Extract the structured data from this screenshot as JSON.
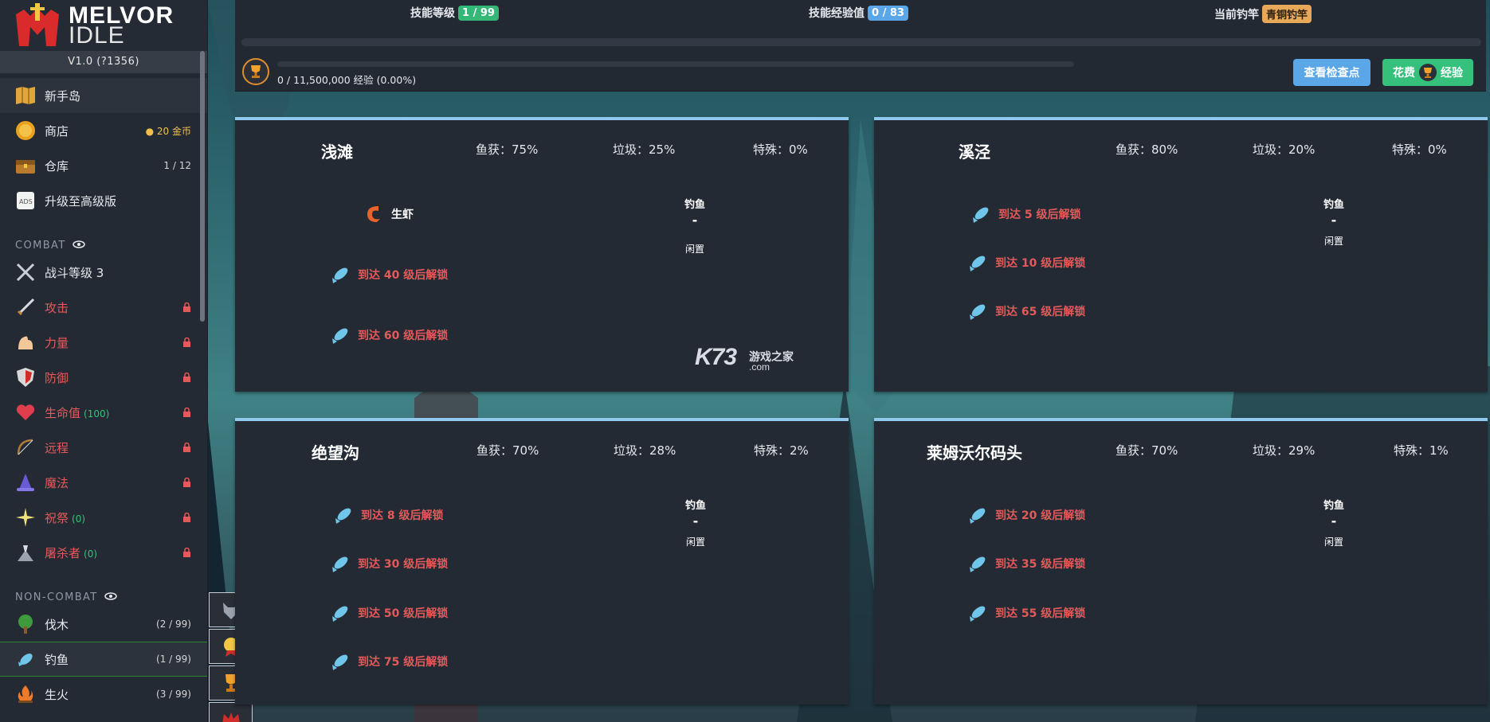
{
  "app": {
    "logo_line1": "MELVOR",
    "logo_line2": "IDLE",
    "version": "V1.0 (?1356)"
  },
  "sidebar": {
    "items_top": [
      {
        "label": "新手岛",
        "icon": "map-icon",
        "right": ""
      },
      {
        "label": "商店",
        "icon": "coin-icon",
        "right": "20 金币"
      },
      {
        "label": "仓库",
        "icon": "chest-icon",
        "right": "1 / 12"
      },
      {
        "label": "升级至高级版",
        "icon": "ads-icon",
        "right": ""
      }
    ],
    "combat_header": "COMBAT",
    "combat_items": [
      {
        "label": "战斗等级 3",
        "icon": "crossed-swords-icon",
        "sub": ""
      },
      {
        "label": "攻击",
        "icon": "sword-icon",
        "sub": ""
      },
      {
        "label": "力量",
        "icon": "flexed-arm-icon",
        "sub": ""
      },
      {
        "label": "防御",
        "icon": "shield-icon",
        "sub": ""
      },
      {
        "label": "生命值",
        "icon": "heart-icon",
        "sub": "(100)"
      },
      {
        "label": "远程",
        "icon": "bow-icon",
        "sub": ""
      },
      {
        "label": "魔法",
        "icon": "wizard-hat-icon",
        "sub": ""
      },
      {
        "label": "祝祭",
        "icon": "sparkle-icon",
        "sub": "(0)"
      },
      {
        "label": "屠杀者",
        "icon": "slayer-icon",
        "sub": "(0)"
      }
    ],
    "noncombat_header": "NON-COMBAT",
    "noncombat_items": [
      {
        "label": "伐木",
        "icon": "tree-icon",
        "right": "(2 / 99)"
      },
      {
        "label": "钓鱼",
        "icon": "fish-icon",
        "right": "(1 / 99)"
      },
      {
        "label": "生火",
        "icon": "campfire-icon",
        "right": "(3 / 99)"
      }
    ]
  },
  "top": {
    "skill_level_label": "技能等级",
    "skill_level_value": "1 / 99",
    "skill_xp_label": "技能经验值",
    "skill_xp_value": "0 / 83",
    "rod_label": "当前钓竿",
    "rod_value": "青铜钓竿",
    "mastery_text": "0 / 11,500,000 经验 (0.00%)",
    "checkpoint_button": "查看检查点",
    "spend_button_prefix": "花费",
    "spend_button_suffix": "经验"
  },
  "areas": [
    {
      "name": "浅滩",
      "catch": "鱼获：75%",
      "junk": "垃圾：25%",
      "special": "特殊：0%",
      "fish": [
        {
          "label": "生虾",
          "locked": false
        },
        {
          "label": "到达 40 级后解锁",
          "locked": true
        },
        {
          "label": "到达 60 级后解锁",
          "locked": true
        }
      ],
      "fishing_label": "钓鱼",
      "fishing_value": "-",
      "status": "闲置"
    },
    {
      "name": "溪泾",
      "catch": "鱼获：80%",
      "junk": "垃圾：20%",
      "special": "特殊：0%",
      "fish": [
        {
          "label": "到达 5 级后解锁",
          "locked": true
        },
        {
          "label": "到达 10 级后解锁",
          "locked": true
        },
        {
          "label": "到达 65 级后解锁",
          "locked": true
        }
      ],
      "fishing_label": "钓鱼",
      "fishing_value": "-",
      "status": "闲置"
    },
    {
      "name": "绝望沟",
      "catch": "鱼获：70%",
      "junk": "垃圾：28%",
      "special": "特殊：2%",
      "fish": [
        {
          "label": "到达 8 级后解锁",
          "locked": true
        },
        {
          "label": "到达 30 级后解锁",
          "locked": true
        },
        {
          "label": "到达 50 级后解锁",
          "locked": true
        },
        {
          "label": "到达 75 级后解锁",
          "locked": true
        }
      ],
      "fishing_label": "钓鱼",
      "fishing_value": "-",
      "status": "闲置"
    },
    {
      "name": "莱姆沃尔码头",
      "catch": "鱼获：70%",
      "junk": "垃圾：29%",
      "special": "特殊：1%",
      "fish": [
        {
          "label": "到达 20 级后解锁",
          "locked": true
        },
        {
          "label": "到达 35 级后解锁",
          "locked": true
        },
        {
          "label": "到达 55 级后解锁",
          "locked": true
        }
      ],
      "fishing_label": "钓鱼",
      "fishing_value": "-",
      "status": "闲置"
    }
  ],
  "watermark": {
    "logo": "K73",
    "cn": "游戏之家",
    "com": ".com"
  },
  "colors": {
    "accent_green": "#35b877",
    "accent_blue": "#5aa6e6",
    "gold": "#e8a85a",
    "locked_red": "#e45a5a",
    "card_top": "#8fc9ee"
  }
}
